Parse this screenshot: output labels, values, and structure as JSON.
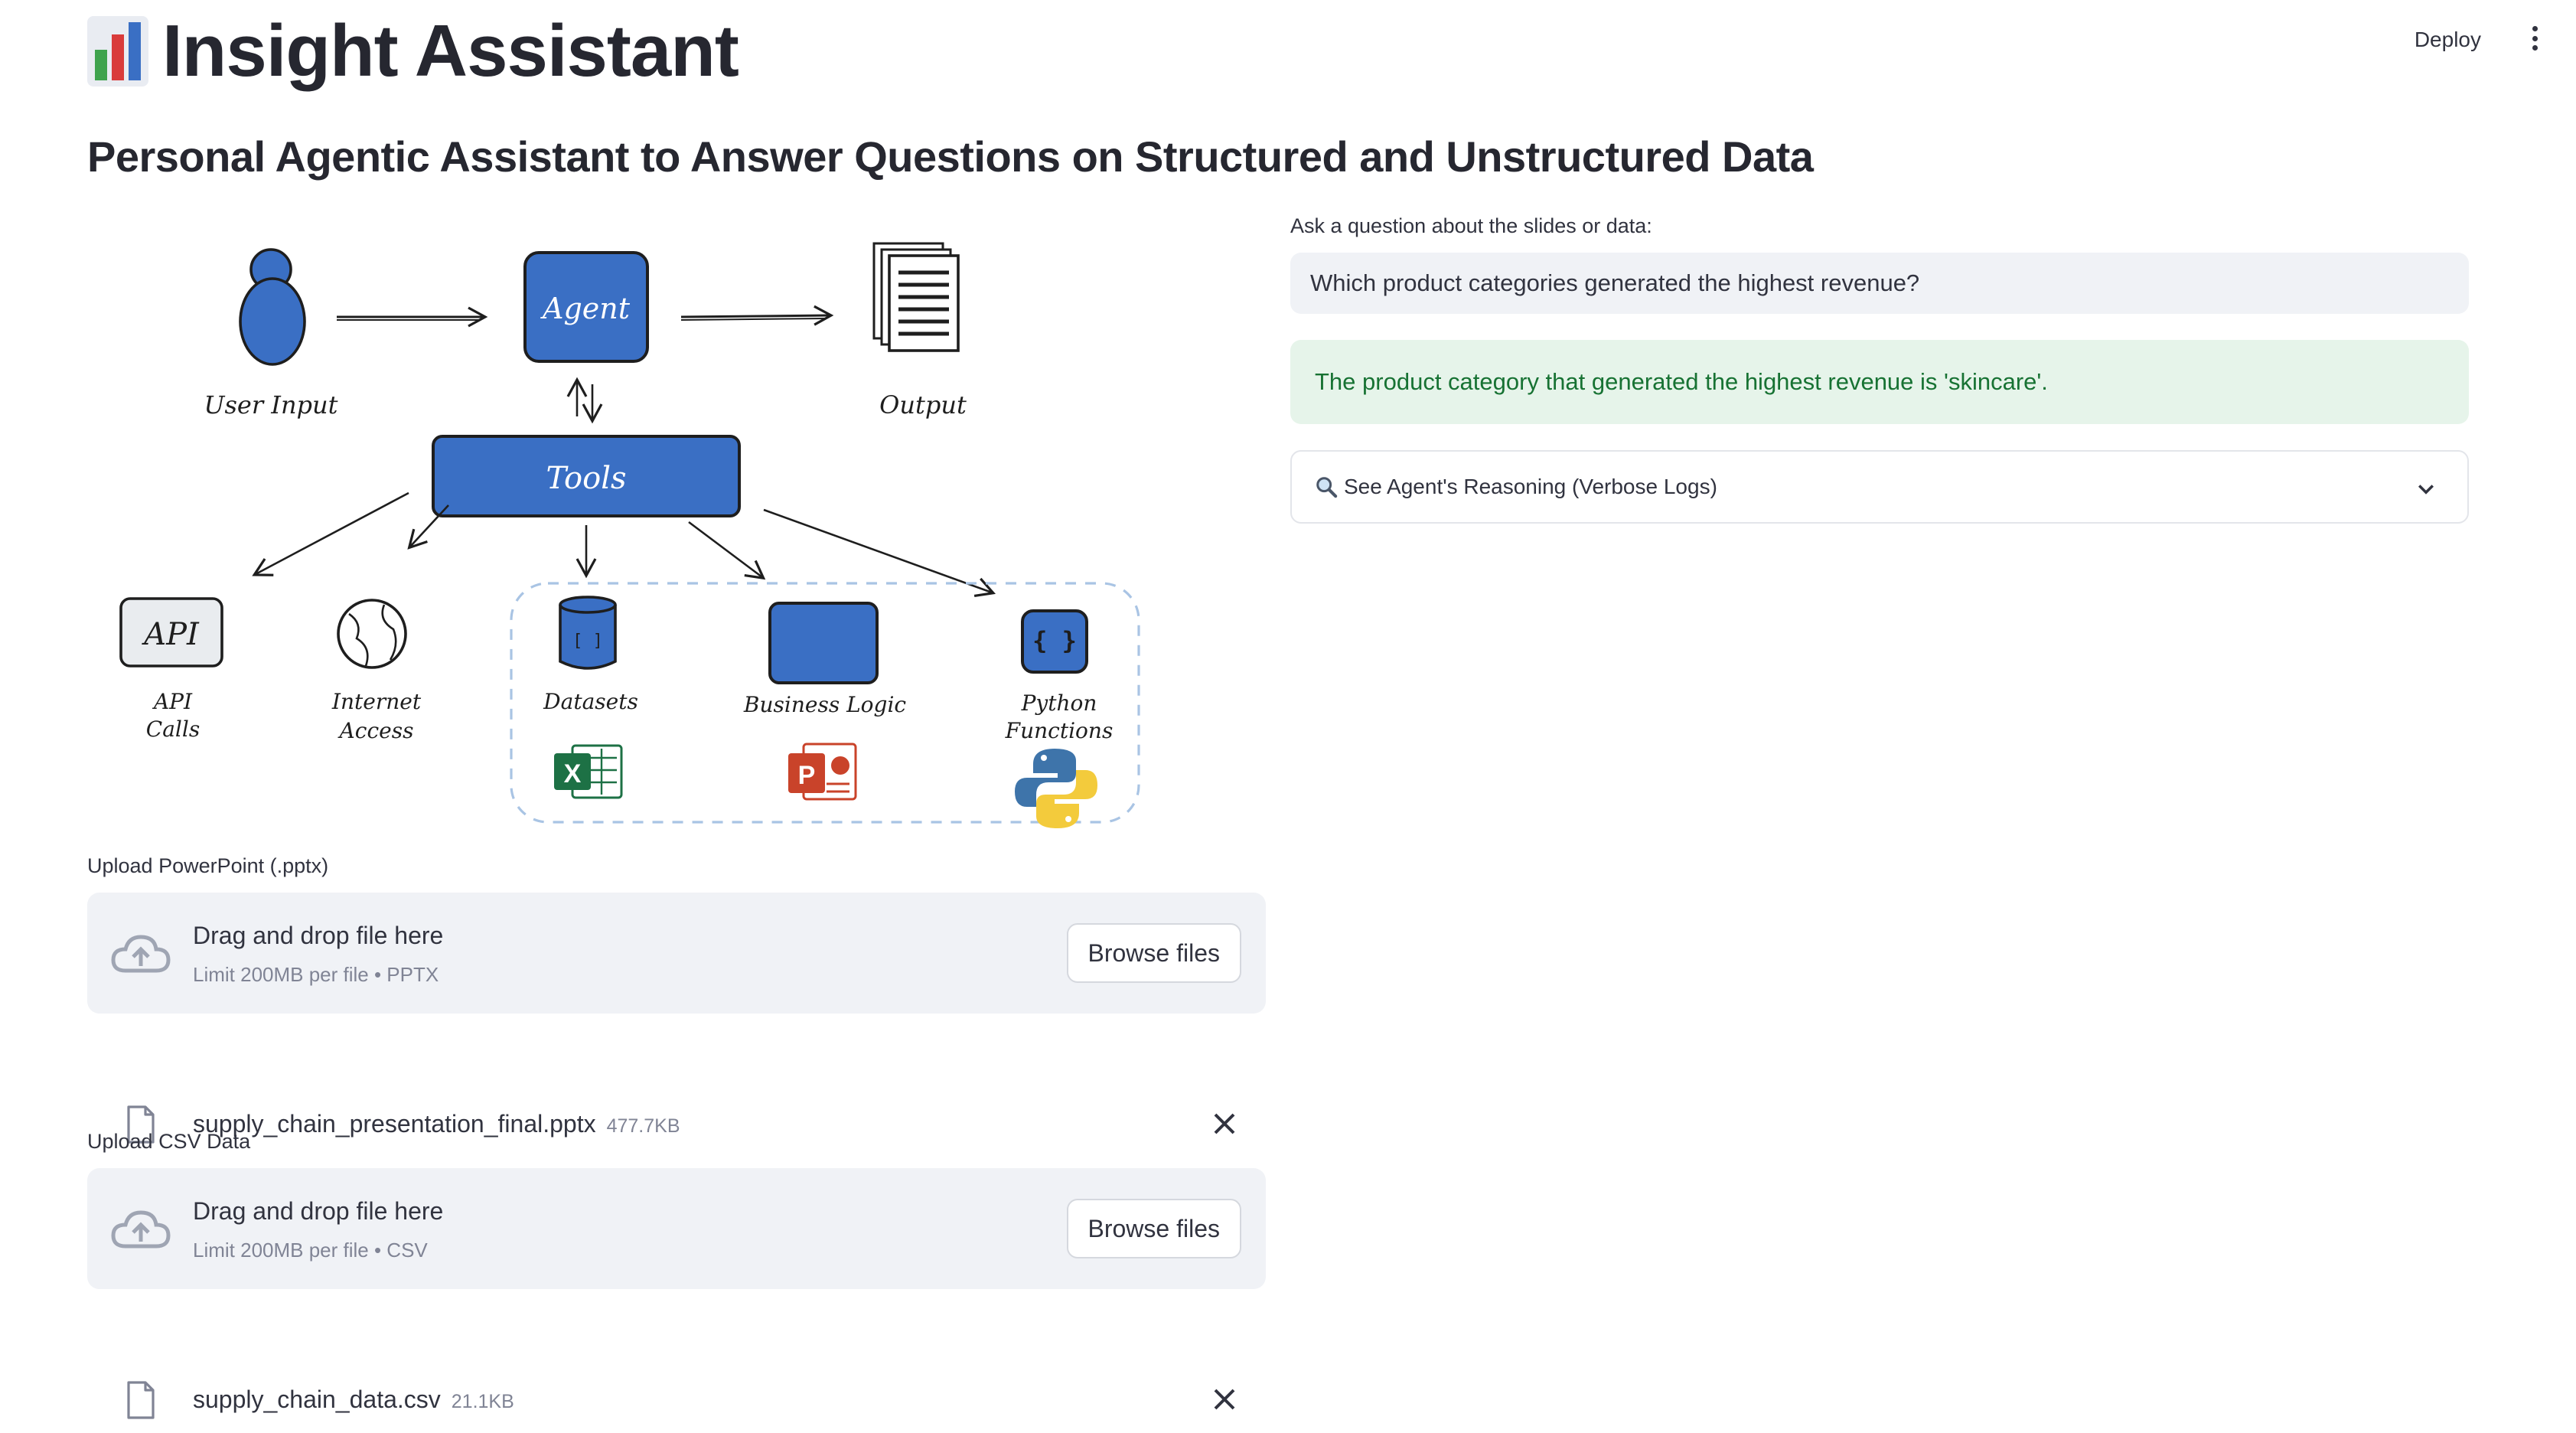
{
  "header": {
    "deploy_label": "Deploy",
    "menu_icon": "kebab-menu-icon"
  },
  "app": {
    "title_icon": "bar-chart-icon",
    "title": "Insight Assistant",
    "subtitle": "Personal Agentic Assistant to Answer Questions on Structured and Unstructured Data"
  },
  "diagram": {
    "user_input": "User Input",
    "agent": "Agent",
    "output": "Output",
    "tools": "Tools",
    "api_box": "API",
    "api_label_1": "API",
    "api_label_2": "Calls",
    "internet_label_1": "Internet",
    "internet_label_2": "Access",
    "datasets": "Datasets",
    "dataset_icon_text": "[ ]",
    "business_logic": "Business Logic",
    "python_label_1": "Python",
    "python_label_2": "Functions",
    "python_icon_text": "{ }",
    "excel_letter": "X",
    "ppt_letter": "P",
    "colors": {
      "blue": "#3a6fc4",
      "excel_green": "#1d7145",
      "ppt_orange": "#c9432a",
      "python_blue": "#3e74aa",
      "python_yellow": "#f3cb3c"
    }
  },
  "uploads": {
    "pptx": {
      "label": "Upload PowerPoint (.pptx)",
      "drop_title": "Drag and drop file here",
      "limit": "Limit 200MB per file • PPTX",
      "browse_label": "Browse files",
      "file_name": "supply_chain_presentation_final.pptx",
      "file_size": "477.7KB"
    },
    "csv": {
      "label": "Upload CSV Data",
      "drop_title": "Drag and drop file here",
      "limit": "Limit 200MB per file • CSV",
      "browse_label": "Browse files",
      "file_name": "supply_chain_data.csv",
      "file_size": "21.1KB"
    }
  },
  "qa": {
    "question_label": "Ask a question about the slides or data:",
    "question_value": "Which product categories generated the highest revenue?",
    "answer": "The product category that generated the highest revenue is 'skincare'.",
    "expander_icon": "magnifier-icon",
    "expander_label": "See Agent's Reasoning (Verbose Logs)",
    "colors": {
      "answer_bg": "#e6f4ea",
      "answer_text": "#177233"
    }
  }
}
